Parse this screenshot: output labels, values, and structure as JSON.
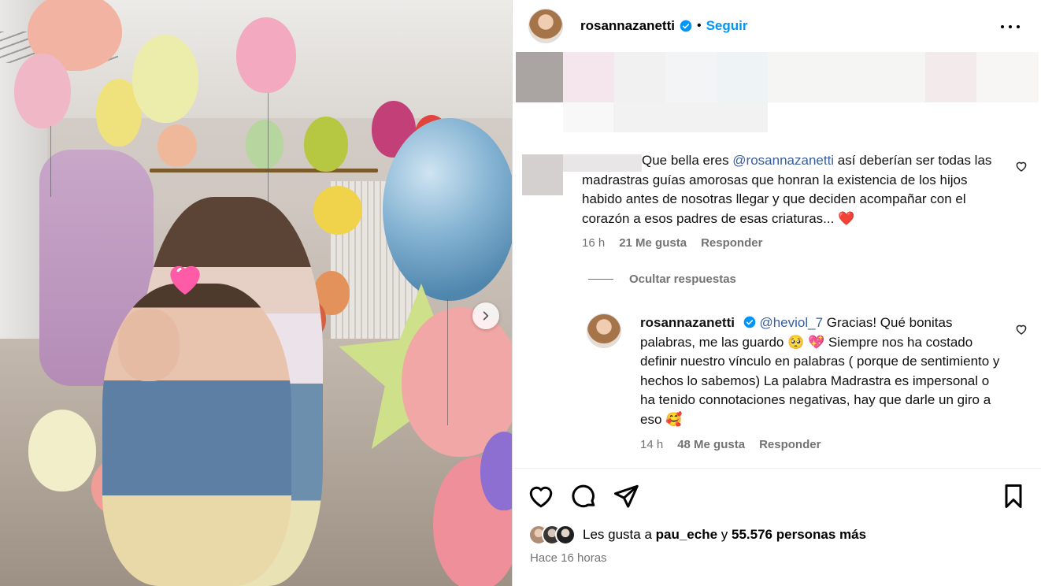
{
  "post": {
    "username": "rosannazanetti",
    "follow_label": "Seguir",
    "dot": "•"
  },
  "comments": [
    {
      "text_before": "Que bella eres ",
      "mention": "@rosannazanetti",
      "text_after": " así deberían ser todas las madrastras guías amorosas que honran la existencia de los hijos habido antes de nosotras llegar y que deciden acompañar con el corazón a esos padres de esas criaturas... ❤️",
      "time": "16 h",
      "likes": "21 Me gusta",
      "reply_label": "Responder"
    }
  ],
  "hide_replies_label": "Ocultar respuestas",
  "reply": {
    "username": "rosannazanetti",
    "mention": "@heviol_7",
    "text": " Gracias! Qué bonitas palabras, me las guardo 🥺 💖 Siempre nos ha costado definir nuestro vínculo en palabras ( porque de sentimiento y hechos lo sabemos) La palabra Madrastra es impersonal o ha tenido connotaciones negativas, hay que darle un giro a eso 🥰",
    "time": "14 h",
    "likes": "48 Me gusta",
    "reply_label": "Responder"
  },
  "likes": {
    "prefix": "Les gusta a ",
    "user": "pau_eche",
    "middle": " y ",
    "count": "55.576 personas más"
  },
  "time_ago": "Hace 16 horas",
  "colors": {
    "link": "#0095f6",
    "mention": "#385e9d",
    "muted": "#737373",
    "verified": "#0095f6"
  },
  "icons": [
    "verified-badge-icon",
    "more-options-icon",
    "heart-icon",
    "comment-icon",
    "share-icon",
    "bookmark-icon",
    "chevron-right-icon"
  ]
}
